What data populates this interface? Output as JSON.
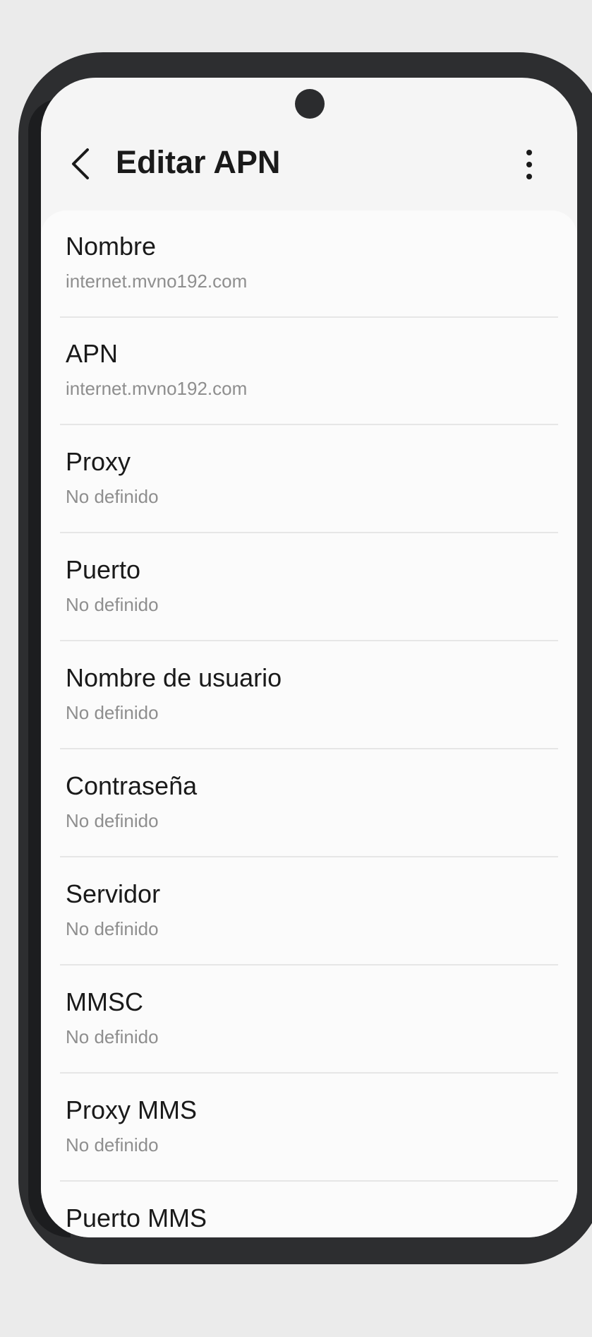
{
  "header": {
    "title": "Editar APN",
    "back_icon": "chevron-left-icon",
    "more_icon": "more-vertical-icon"
  },
  "settings": [
    {
      "label": "Nombre",
      "value": "internet.mvno192.com"
    },
    {
      "label": "APN",
      "value": "internet.mvno192.com"
    },
    {
      "label": "Proxy",
      "value": "No definido"
    },
    {
      "label": "Puerto",
      "value": "No definido"
    },
    {
      "label": "Nombre de usuario",
      "value": "No definido"
    },
    {
      "label": "Contraseña",
      "value": "No definido"
    },
    {
      "label": "Servidor",
      "value": "No definido"
    },
    {
      "label": "MMSC",
      "value": "No definido"
    },
    {
      "label": "Proxy MMS",
      "value": "No definido"
    },
    {
      "label": "Puerto MMS",
      "value": ""
    }
  ],
  "colors": {
    "background": "#ebebeb",
    "phone_frame": "#2d2e30",
    "screen": "#f5f5f5",
    "card": "#fbfbfb",
    "primary_text": "#1a1a1a",
    "secondary_text": "#8e8e8e"
  }
}
